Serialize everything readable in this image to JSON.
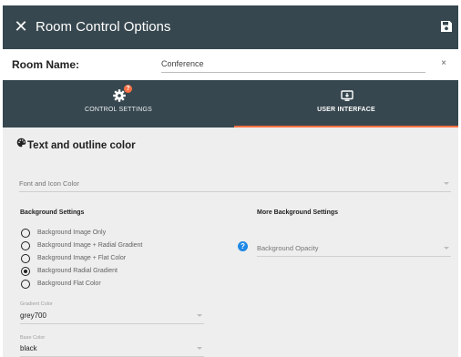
{
  "header": {
    "title": "Room Control Options",
    "close_icon": "close-icon",
    "save_icon": "save-icon"
  },
  "room": {
    "label": "Room Name:",
    "value": "Conference",
    "clear_icon": "×"
  },
  "tabs": [
    {
      "label": "CONTROL SETTINGS",
      "icon": "gear-icon",
      "badge": "?",
      "active": false
    },
    {
      "label": "USER INTERFACE",
      "icon": "display-icon",
      "active": true
    }
  ],
  "section": {
    "icon": "palette-icon",
    "title": "Text and outline color"
  },
  "font_icon_color": {
    "placeholder": "Font and Icon Color"
  },
  "background": {
    "heading": "Background Settings",
    "options": [
      {
        "label": "Background Image Only",
        "selected": false
      },
      {
        "label": "Background Image + Radial Gradient",
        "selected": false
      },
      {
        "label": "Background Image + Flat Color",
        "selected": false
      },
      {
        "label": "Background Radial Gradient",
        "selected": true
      },
      {
        "label": "Background Flat Color",
        "selected": false
      }
    ],
    "gradient_color": {
      "label": "Gradient Color",
      "value": "grey700"
    },
    "base_color": {
      "label": "Base Color",
      "value": "black"
    }
  },
  "more_background": {
    "heading": "More Background Settings",
    "help_icon": "?",
    "opacity": {
      "placeholder": "Background Opacity"
    }
  },
  "colors": {
    "header_bg": "#37474f",
    "accent": "#ff7043",
    "help": "#1e88e5",
    "content_bg": "#eeeeee"
  }
}
